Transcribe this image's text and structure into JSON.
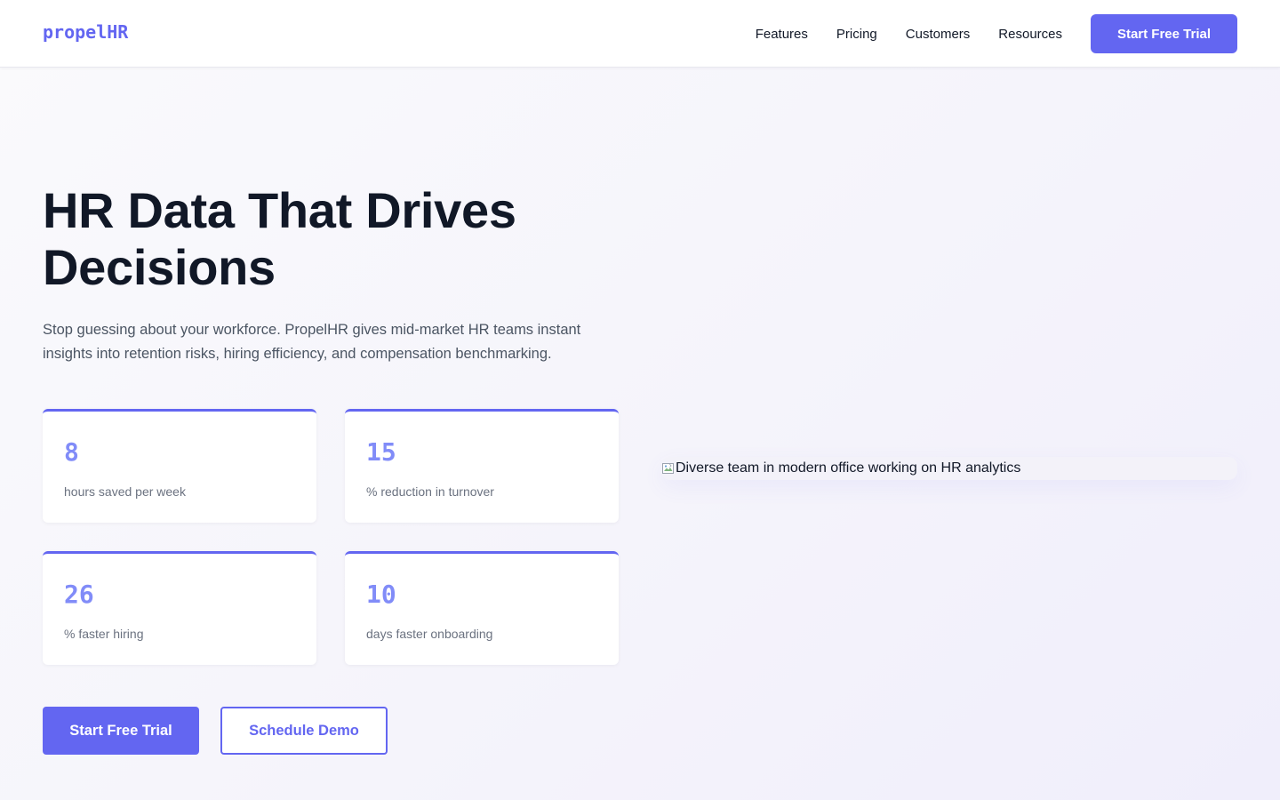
{
  "brand": {
    "logo_text": "propelHR",
    "accent_color": "#6366f1"
  },
  "nav": {
    "items": [
      {
        "label": "Features"
      },
      {
        "label": "Pricing"
      },
      {
        "label": "Customers"
      },
      {
        "label": "Resources"
      }
    ],
    "cta_label": "Start Free Trial"
  },
  "hero": {
    "title": "HR Data That Drives Decisions",
    "subtitle": "Stop guessing about your workforce. PropelHR gives mid-market HR teams instant insights into retention risks, hiring efficiency, and compensation benchmarking.",
    "stats": [
      {
        "value": "8",
        "label": "hours saved per week"
      },
      {
        "value": "15",
        "label": "% reduction in turnover"
      },
      {
        "value": "26",
        "label": "% faster hiring"
      },
      {
        "value": "10",
        "label": "days faster onboarding"
      }
    ],
    "primary_cta": "Start Free Trial",
    "secondary_cta": "Schedule Demo",
    "image": {
      "alt": "Diverse team in modern office working on HR analytics",
      "icon": "broken-image-icon"
    }
  }
}
